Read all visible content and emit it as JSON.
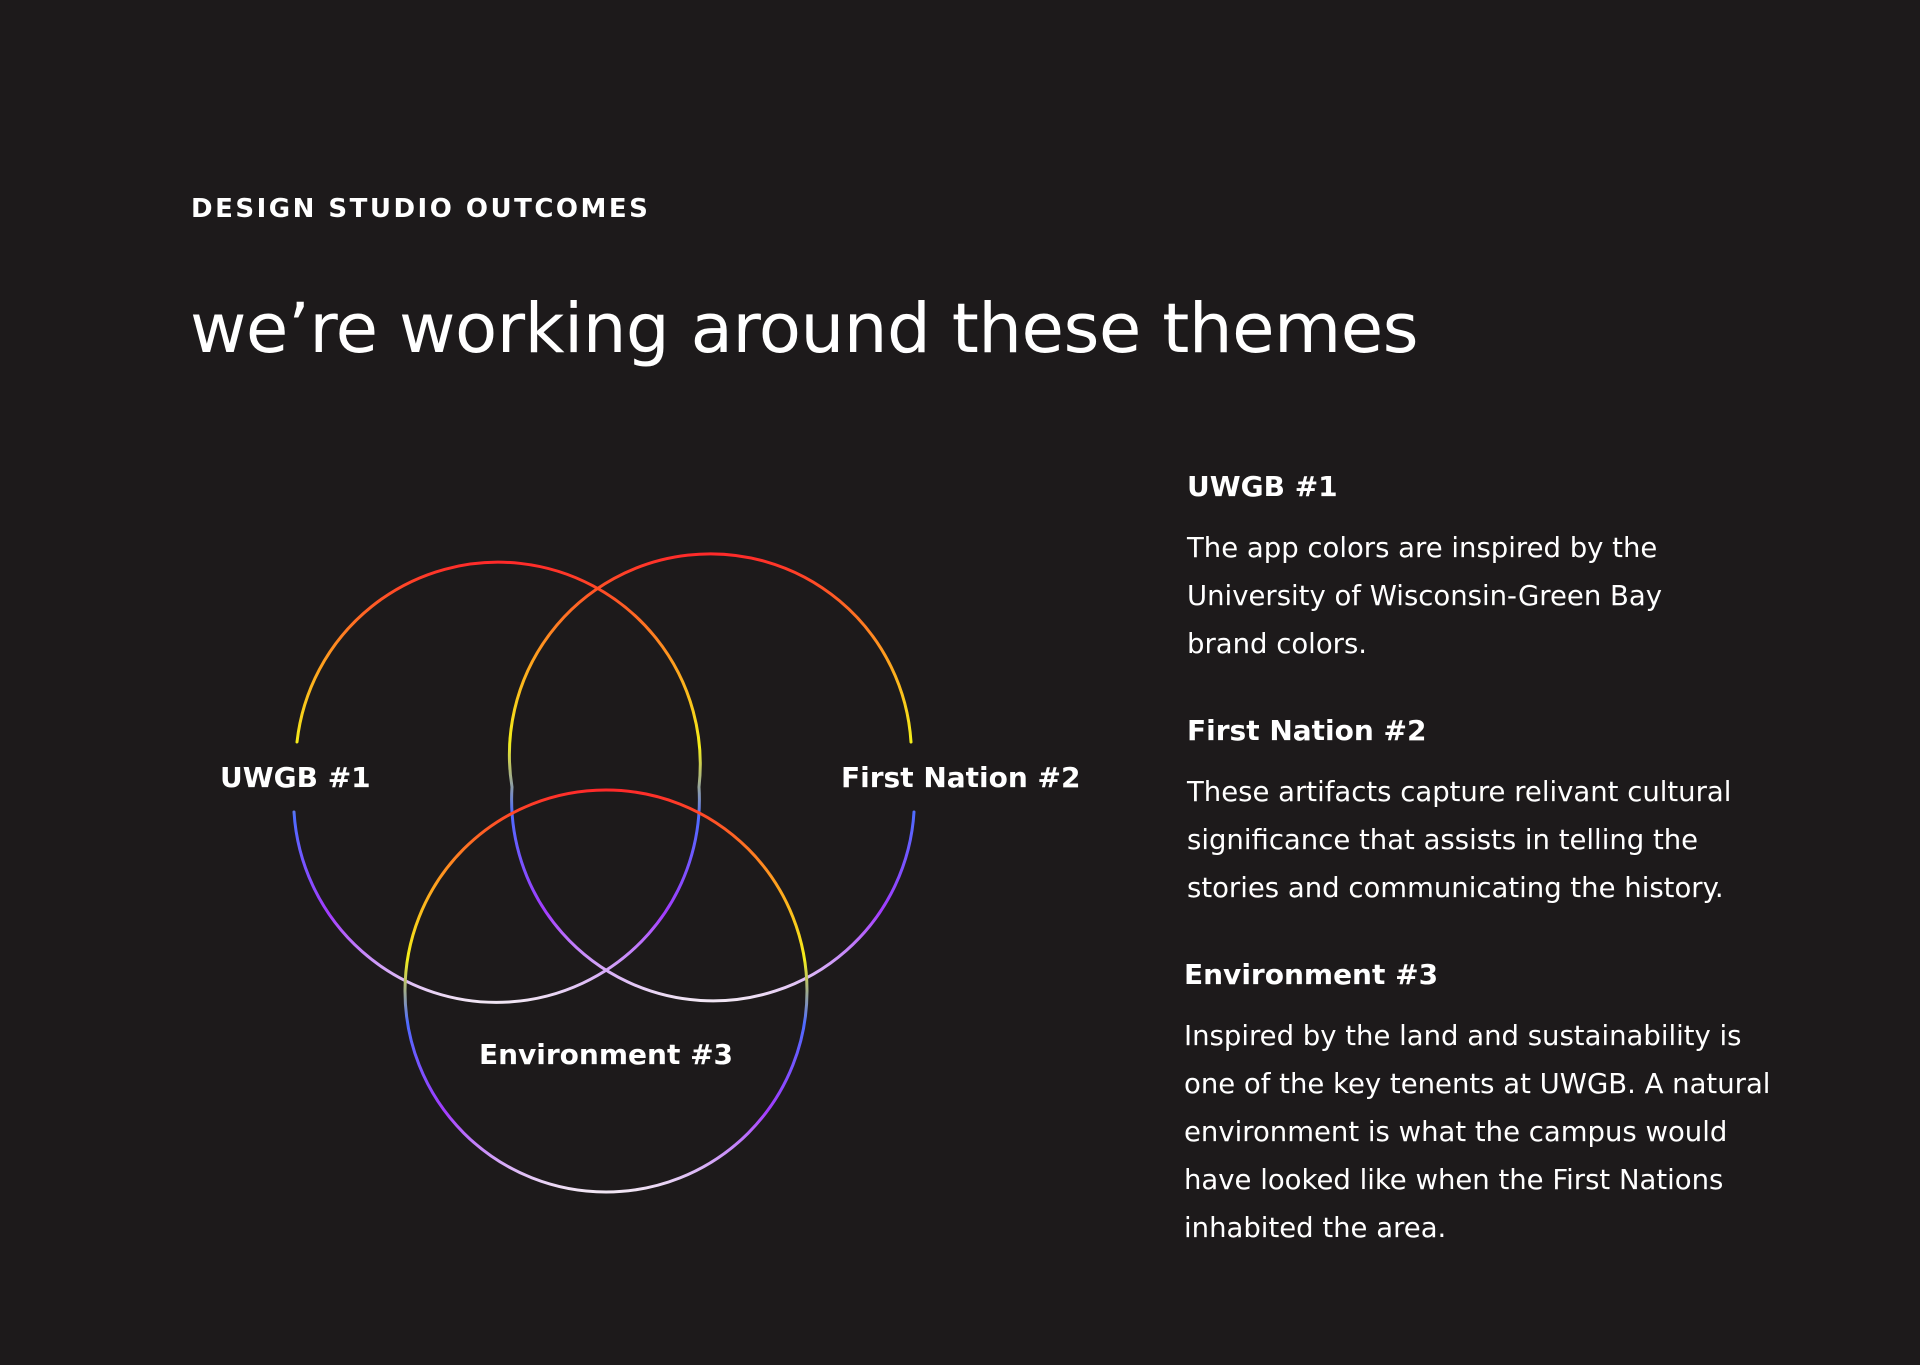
{
  "eyebrow": "DESIGN STUDIO OUTCOMES",
  "headline": "we’re working around these themes",
  "venn": {
    "labels": [
      "UWGB #1",
      "First Nation #2",
      "Environment #3"
    ],
    "gradient_colors": [
      "#ff2a2a",
      "#ff9a1f",
      "#f4ef1a",
      "#4e6bff",
      "#a33cff",
      "#f1e6f4"
    ]
  },
  "themes": [
    {
      "title": "UWGB #1",
      "lines": [
        "The app colors are inspired by the",
        "University of Wisconsin-Green Bay",
        "brand colors."
      ]
    },
    {
      "title": "First Nation #2",
      "lines": [
        "These artifacts capture relivant cultural",
        "significance that assists in telling the",
        "stories and communicating the history."
      ]
    },
    {
      "title": "Environment #3",
      "lines": [
        "Inspired by the land and sustainability is",
        "one of the key tenents at UWGB. A natural",
        "environment is what the campus would",
        "have looked like when the First Nations",
        "inhabited the area."
      ]
    }
  ]
}
